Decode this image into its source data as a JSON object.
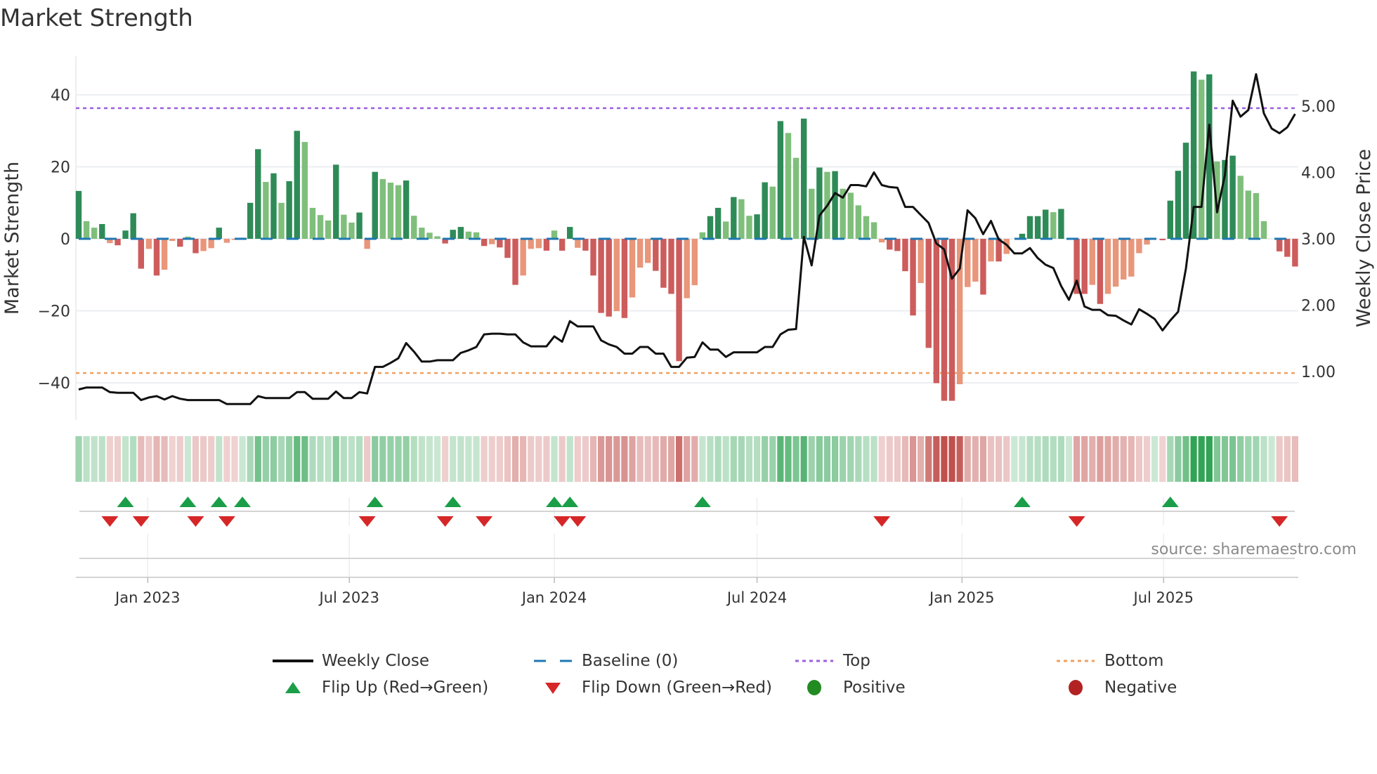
{
  "title": "Market Strength",
  "source": "source: sharemaestro.com",
  "colors": {
    "bar_pos_strong": "#2e8b57",
    "bar_pos_weak": "#7fbf7b",
    "bar_neg_strong": "#cd5c5c",
    "bar_neg_weak": "#e9967a",
    "price_line": "#111111",
    "baseline": "#1f77b4",
    "top": "#9b5fe0",
    "bottom": "#f0a060",
    "flip_up": "#1a9e48",
    "flip_down": "#d62728",
    "positive": "#228b22",
    "negative": "#b22222",
    "heat_pos": "49,163,84",
    "heat_neg": "192,80,77"
  },
  "legend": [
    {
      "label": "Weekly Close",
      "icon": "solid-line"
    },
    {
      "label": "Baseline (0)",
      "icon": "dashed-line"
    },
    {
      "label": "Top",
      "icon": "dotted-purple-line"
    },
    {
      "label": "Bottom",
      "icon": "dotted-orange-line"
    },
    {
      "label": "Flip Up (Red→Green)",
      "icon": "triangle-up"
    },
    {
      "label": "Flip Down (Green→Red)",
      "icon": "triangle-down"
    },
    {
      "label": "Positive",
      "icon": "green-dot"
    },
    {
      "label": "Negative",
      "icon": "red-dot"
    }
  ],
  "chart_data": {
    "type": "bar",
    "title": "Market Strength",
    "ylabel": "Market Strength",
    "y2label": "Weekly Close Price",
    "ylim": [
      -50,
      50
    ],
    "y_ticks": [
      40,
      20,
      0,
      -20,
      -40
    ],
    "y_tick_labels": [
      "40",
      "20",
      "0",
      "−20",
      "−40"
    ],
    "y2_ticks": [
      5,
      4,
      3,
      2,
      1
    ],
    "y2_tick_labels": [
      "5.00",
      "4.00",
      "3.00",
      "2.00",
      "1.00"
    ],
    "x_ticks": [
      {
        "date": "2023-01-01",
        "label": "Jan 2023"
      },
      {
        "date": "2023-07-01",
        "label": "Jul 2023"
      },
      {
        "date": "2024-01-01",
        "label": "Jan 2024"
      },
      {
        "date": "2024-07-01",
        "label": "Jul 2024"
      },
      {
        "date": "2025-01-01",
        "label": "Jan 2025"
      },
      {
        "date": "2025-07-01",
        "label": "Jul 2025"
      }
    ],
    "start_date": "2022-10-31",
    "frequency": "weekly",
    "top_level": 36.3,
    "bottom_level": -37.3,
    "strength": [
      13.3,
      4.9,
      3.1,
      4.1,
      -1.2,
      -1.8,
      2.3,
      7.1,
      -8.3,
      -2.8,
      -10.2,
      -8.6,
      -0.6,
      -2.2,
      0.6,
      -4.0,
      -3.4,
      -2.6,
      3.1,
      -1.1,
      -0.3,
      0.3,
      10.0,
      24.9,
      15.8,
      18.2,
      10.0,
      16.0,
      30.0,
      26.9,
      8.6,
      6.6,
      5.1,
      20.6,
      6.7,
      4.5,
      7.3,
      -2.8,
      18.6,
      16.6,
      15.6,
      14.9,
      16.2,
      6.4,
      3.1,
      1.7,
      0.7,
      -1.3,
      2.5,
      3.3,
      2.0,
      1.8,
      -2.0,
      -1.5,
      -2.4,
      -5.3,
      -12.8,
      -10.2,
      -2.8,
      -2.6,
      -3.3,
      2.3,
      -3.3,
      3.3,
      -2.5,
      -3.3,
      -10.2,
      -20.6,
      -21.6,
      -20.1,
      -22.0,
      -16.3,
      -8.0,
      -6.7,
      -8.9,
      -13.6,
      -15.3,
      -34.0,
      -16.5,
      -12.9,
      1.8,
      6.3,
      8.6,
      4.8,
      11.6,
      11.0,
      6.4,
      6.8,
      15.7,
      14.5,
      32.7,
      29.4,
      22.5,
      33.4,
      13.9,
      19.8,
      18.6,
      18.8,
      13.9,
      12.8,
      9.3,
      6.3,
      4.6,
      -1.0,
      -3.0,
      -3.4,
      -9.0,
      -21.3,
      -12.3,
      -30.3,
      -40.1,
      -45.0,
      -45.0,
      -40.4,
      -13.4,
      -11.9,
      -15.5,
      -6.3,
      -6.3,
      -4.2,
      0,
      1.4,
      6.3,
      6.3,
      8.1,
      7.4,
      8.3,
      0,
      -15.3,
      -15.3,
      -12.8,
      -18.1,
      -15.3,
      -13.3,
      -11.3,
      -10.5,
      -4.0,
      -1.6,
      0,
      -0.4,
      10.6,
      18.9,
      26.7,
      46.5,
      44.2,
      45.7,
      21.5,
      21.9,
      23.1,
      17.5,
      13.4,
      12.7,
      4.9,
      0,
      -3.5,
      -5.0,
      -7.7
    ],
    "weekly_close": [
      0.73,
      0.76,
      0.76,
      0.76,
      0.69,
      0.68,
      0.68,
      0.68,
      0.57,
      0.61,
      0.63,
      0.58,
      0.63,
      0.59,
      0.57,
      0.57,
      0.57,
      0.57,
      0.57,
      0.51,
      0.51,
      0.51,
      0.51,
      0.63,
      0.6,
      0.6,
      0.6,
      0.6,
      0.69,
      0.69,
      0.59,
      0.59,
      0.59,
      0.7,
      0.6,
      0.6,
      0.69,
      0.67,
      1.07,
      1.07,
      1.13,
      1.2,
      1.43,
      1.3,
      1.15,
      1.15,
      1.17,
      1.17,
      1.17,
      1.28,
      1.32,
      1.37,
      1.56,
      1.57,
      1.57,
      1.56,
      1.56,
      1.44,
      1.38,
      1.38,
      1.38,
      1.53,
      1.45,
      1.76,
      1.68,
      1.68,
      1.68,
      1.47,
      1.41,
      1.37,
      1.27,
      1.27,
      1.37,
      1.37,
      1.27,
      1.27,
      1.07,
      1.07,
      1.21,
      1.22,
      1.44,
      1.33,
      1.33,
      1.22,
      1.29,
      1.29,
      1.29,
      1.29,
      1.37,
      1.37,
      1.56,
      1.63,
      1.64,
      3.03,
      2.6,
      3.35,
      3.5,
      3.69,
      3.62,
      3.81,
      3.81,
      3.79,
      4.0,
      3.81,
      3.78,
      3.77,
      3.48,
      3.48,
      3.36,
      3.24,
      2.93,
      2.84,
      2.4,
      2.55,
      3.43,
      3.31,
      3.07,
      3.27,
      2.99,
      2.91,
      2.78,
      2.78,
      2.86,
      2.71,
      2.61,
      2.56,
      2.29,
      2.08,
      2.37,
      1.98,
      1.93,
      1.93,
      1.85,
      1.84,
      1.77,
      1.71,
      1.94,
      1.87,
      1.79,
      1.62,
      1.77,
      1.9,
      2.55,
      3.48,
      3.48,
      4.72,
      3.4,
      3.96,
      5.08,
      4.84,
      4.94,
      5.48,
      4.89,
      4.66,
      4.59,
      4.68,
      4.88
    ],
    "flip_up_weeks": [
      6,
      14,
      18,
      21,
      38,
      48,
      61,
      63,
      80,
      121,
      140
    ],
    "flip_down_weeks": [
      4,
      8,
      15,
      19,
      37,
      47,
      52,
      62,
      64,
      103,
      128,
      154
    ],
    "legend_position": "bottom",
    "grid": true
  }
}
